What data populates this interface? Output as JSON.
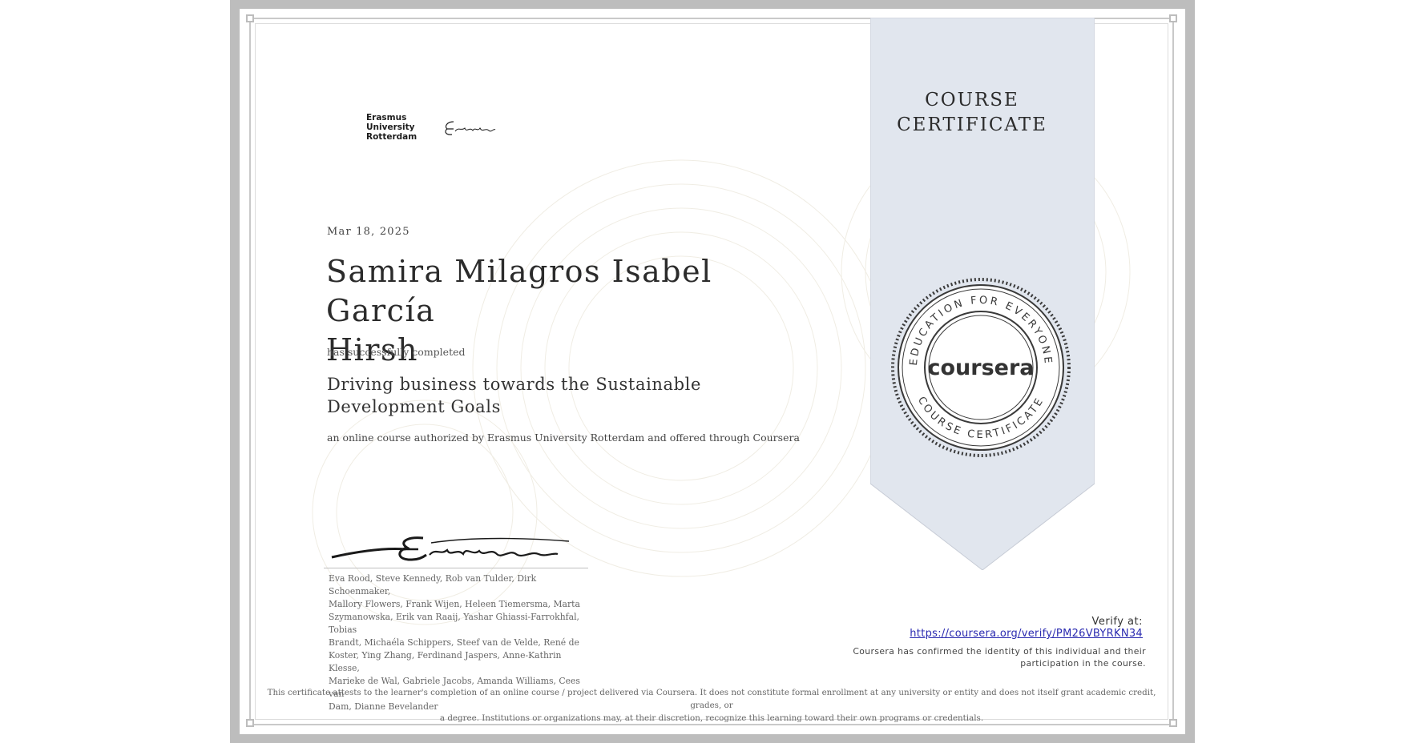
{
  "logo": {
    "lines": [
      "Erasmus",
      "University",
      "Rotterdam"
    ]
  },
  "ribbon": {
    "title_line1": "COURSE",
    "title_line2": "CERTIFICATE"
  },
  "seal": {
    "top_text": "EDUCATION FOR EVERYONE",
    "bottom_text": "COURSE CERTIFICATE",
    "brand": "coursera"
  },
  "certificate": {
    "date": "Mar 18, 2025",
    "recipient_name_line1": "Samira Milagros Isabel García",
    "recipient_name_line2": "Hirsh",
    "completed_text": "has successfully completed",
    "course_title_line1": "Driving business towards the Sustainable",
    "course_title_line2": "Development Goals",
    "authorization": "an online course authorized by Erasmus University Rotterdam and offered through Coursera"
  },
  "instructors": [
    "Eva Rood, Steve Kennedy, Rob van Tulder, Dirk Schoenmaker,",
    "Mallory Flowers, Frank Wijen, Heleen Tiemersma, Marta",
    "Szymanowska, Erik van Raaij, Yashar Ghiassi-Farrokhfal, Tobias",
    "Brandt, Michaéla Schippers, Steef van de Velde, René de",
    "Koster, Ying Zhang, Ferdinand Jaspers, Anne-Kathrin Klesse,",
    "Marieke de Wal, Gabriele Jacobs, Amanda Williams, Cees van",
    "Dam, Dianne Bevelander"
  ],
  "verify": {
    "label": "Verify at:",
    "url": "https://coursera.org/verify/PM26VBYRKN34",
    "identity_line1": "Coursera has confirmed the identity of this individual and their",
    "identity_line2": "participation in the course."
  },
  "disclaimer": {
    "line1": "This certificate attests to the learner's completion of an online course / project delivered via Coursera. It does not constitute formal enrollment at any university or entity and does not itself grant academic credit, grades, or",
    "line2": "a degree. Institutions or organizations may, at their discretion, recognize this learning toward their own programs or credentials."
  },
  "colors": {
    "frame": "#bdbdbd",
    "ribbon": "#e1e6ee",
    "link": "#2a2ab0",
    "seal": "#3a3a3a"
  }
}
